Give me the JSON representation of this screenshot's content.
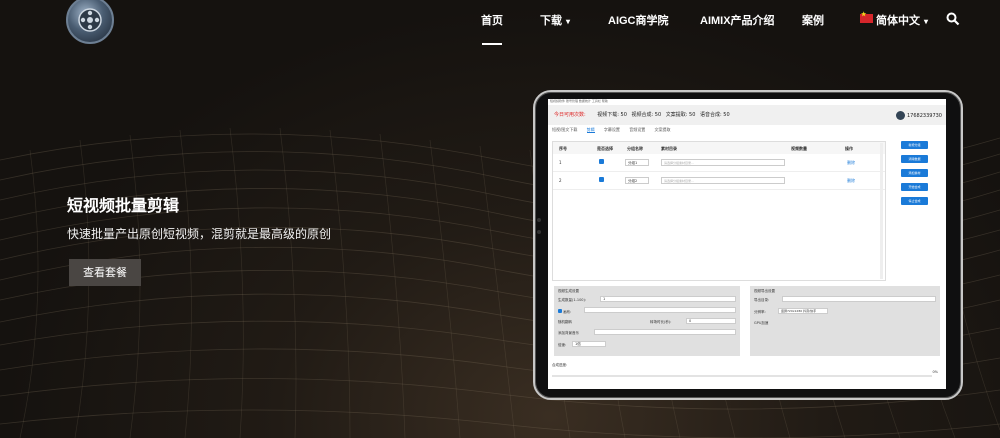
{
  "nav": {
    "home": "首页",
    "download": "下载",
    "aigc": "AIGC商学院",
    "aimix": "AIMIX产品介绍",
    "cases": "案例",
    "language": "简体中文"
  },
  "hero": {
    "title": "短视频批量剪辑",
    "subtitle": "快速批量产出原创短视频，混剪就是最高级的原创",
    "cta": "查看套餐"
  },
  "colors": {
    "accent": "#1a7ad8",
    "cta_bg": "#4a4643",
    "stat_red": "#dd2222"
  },
  "icons": {
    "logo": "logo-icon",
    "search": "search-icon",
    "caret": "chevron-down-icon",
    "flag": "china-flag-icon"
  },
  "app": {
    "topmenu": "短视频软件  账号管理  数据统计  工具栏  帮助",
    "stats_label": "今日可用次数:",
    "stats": {
      "video_download": "视频下载: 50",
      "video_compose": "视频合成: 50",
      "copy_extract": "文案提取: 50",
      "voice_compose": "语音合成: 50"
    },
    "phone": "17682339730",
    "tabs": [
      "短视/图文下载",
      "剪辑",
      "字幕设置",
      "音频设置",
      "文案提取"
    ],
    "active_tab": "剪辑",
    "table": {
      "headers": [
        "序号",
        "是否选择",
        "分组名称",
        "素材目录",
        "视频数量",
        "操作"
      ],
      "rows": [
        {
          "no": "1",
          "group": "分组1",
          "dir": "请选择分组素材目录...",
          "action": "删除"
        },
        {
          "no": "2",
          "group": "分组2",
          "dir": "请选择分组素材目录...",
          "action": "删除"
        }
      ]
    },
    "side_buttons": [
      "新增分组",
      "清除数据",
      "添加素材",
      "开始合成",
      "停止合成"
    ],
    "left_panel": {
      "title": "视频生成设置",
      "count_label": "生成数量(1-100):",
      "count_value": "1",
      "size_label": "画布:",
      "random_label": "随机翻转",
      "transition_label": "转场时长(秒):",
      "transition_value": "0",
      "music_label": "添加背景音乐",
      "speed_label": "倍速:",
      "speed_value": "1倍"
    },
    "right_panel": {
      "title": "视频导出设置",
      "path_label": "导出目录:",
      "res_label": "分辨率:",
      "res_value": "竖屏720x1280 抖音/快手",
      "gpu_label": "GPU加速"
    },
    "progress_label": "合成进度:",
    "progress_value": "0%"
  }
}
